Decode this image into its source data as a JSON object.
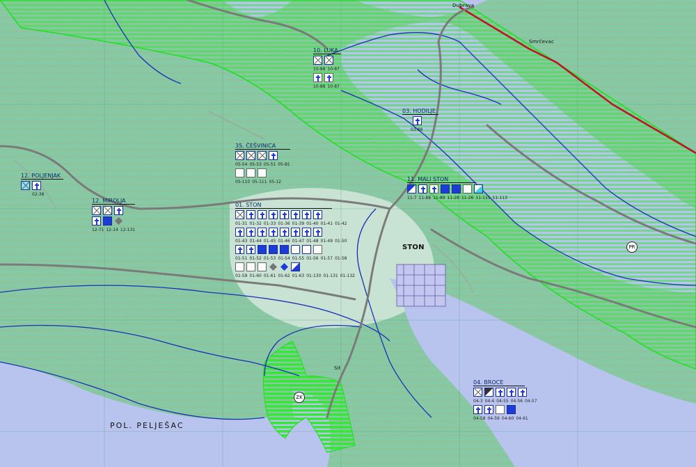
{
  "map": {
    "place_labels": {
      "ston": "STON",
      "peljesac": "POL. PELJEŠAC",
      "smrcevac": "Smrčevac",
      "brijesta": "Dubrava",
      "sit": "Sit"
    },
    "markers": {
      "zk": "ZK",
      "pr": "PR"
    },
    "groups": [
      {
        "id": "g10",
        "title": "10. LUKA",
        "caps": [
          "10-88",
          "10-87"
        ],
        "caps2": [
          "10-88",
          "10-87"
        ]
      },
      {
        "id": "g12a",
        "title": "12. POLJENJAK",
        "caps": [
          "02-38"
        ]
      },
      {
        "id": "g12b",
        "title": "12. MIROLJA",
        "caps": [
          "12-71",
          "12-14",
          "12-131"
        ]
      },
      {
        "id": "g35",
        "title": "35. ČEŠVINICA",
        "caps": [
          "05-54",
          "05-53",
          "05-51",
          "05-81"
        ],
        "caps2": [
          "05-110",
          "05-111",
          "05-12"
        ]
      },
      {
        "id": "g01",
        "title": "01. STON",
        "caps": [
          "01-31",
          "01-32",
          "01-33",
          "01-36",
          "01-39",
          "01-40",
          "01-41",
          "01-42"
        ],
        "caps2": [
          "01-43",
          "01-44",
          "01-45",
          "01-46",
          "01-47",
          "01-48",
          "01-49",
          "01-50"
        ],
        "caps3": [
          "01-51",
          "01-52",
          "01-53",
          "01-54",
          "01-55",
          "01-56",
          "01-57",
          "01-58"
        ],
        "caps4": [
          "01-59",
          "01-60",
          "01-61",
          "01-62",
          "01-63",
          "01-130",
          "01-131",
          "01-132"
        ]
      },
      {
        "id": "g03",
        "title": "03. HODILJE",
        "caps": [
          "03-88"
        ]
      },
      {
        "id": "g11",
        "title": "11. MALI STON",
        "caps": [
          "11-7",
          "11-88",
          "11-89",
          "11-28",
          "11-26",
          "11-115",
          "11-113"
        ]
      },
      {
        "id": "g04",
        "title": "04. BROCE",
        "caps": [
          "04-3",
          "04-4",
          "04-55",
          "04-56",
          "04-57"
        ],
        "caps2": [
          "04-58",
          "04-59",
          "04-60",
          "04-61"
        ]
      }
    ],
    "colors": {
      "sea": "#b9c4ee",
      "land": "#7fc59f",
      "green_zone": "#33e033",
      "boundary_blue": "#1a2fb5",
      "roads": "#777777",
      "red_line": "#c0102a"
    }
  }
}
